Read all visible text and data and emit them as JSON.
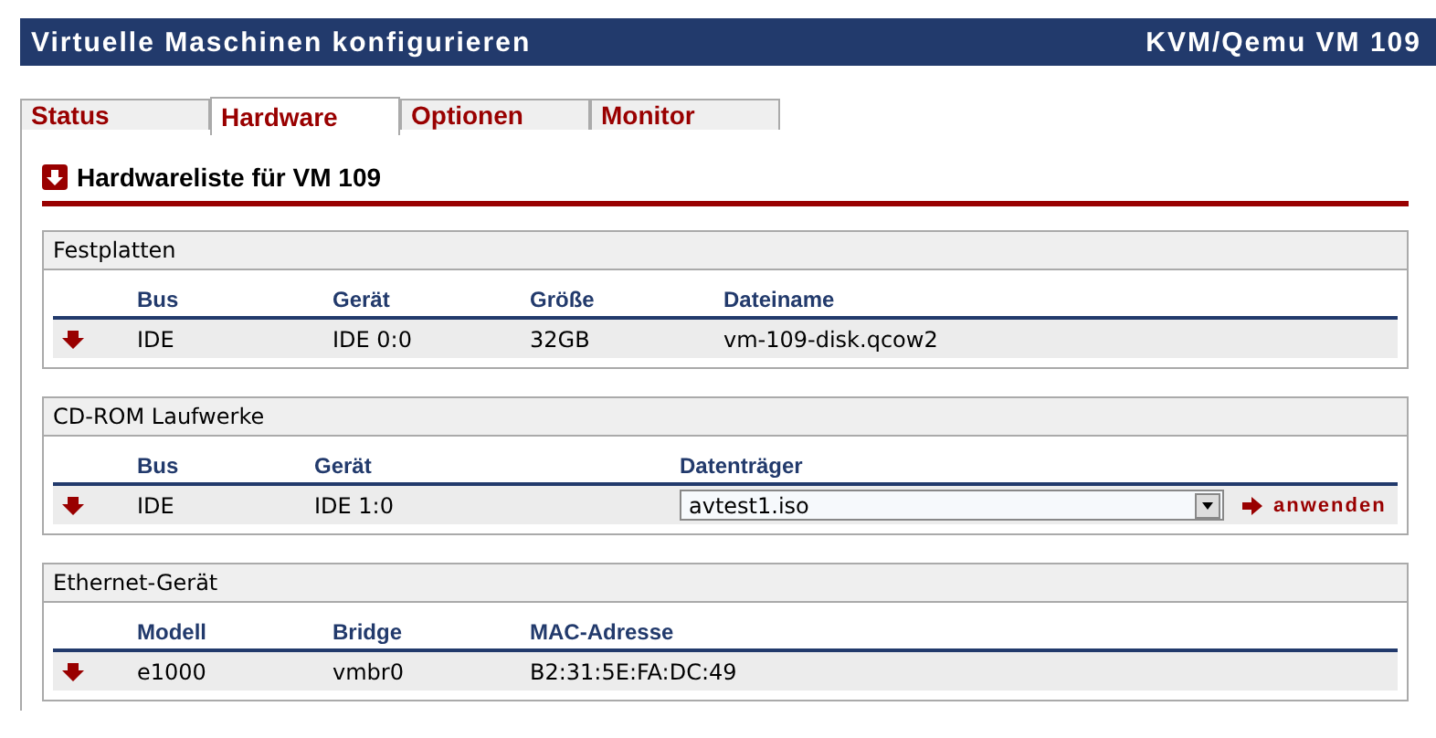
{
  "header": {
    "title": "Virtuelle Maschinen konfigurieren",
    "vm": "KVM/Qemu VM 109"
  },
  "tabs": [
    {
      "label": "Status",
      "selected": false
    },
    {
      "label": "Hardware",
      "selected": true
    },
    {
      "label": "Optionen",
      "selected": false
    },
    {
      "label": "Monitor",
      "selected": false
    }
  ],
  "heading": "Hardwareliste für VM 109",
  "sections": [
    {
      "title": "Festplatten",
      "columns": [
        "Bus",
        "Gerät",
        "Größe",
        "Dateiname"
      ],
      "rows": [
        {
          "cells": [
            "IDE",
            "IDE 0:0",
            "32GB",
            "vm-109-disk.qcow2"
          ]
        }
      ]
    },
    {
      "title": "CD-ROM Laufwerke",
      "columns": [
        "Bus",
        "Gerät",
        "Datenträger"
      ],
      "rows": [
        {
          "cells": [
            "IDE",
            "IDE 1:0"
          ],
          "select": "avtest1.iso",
          "action": "anwenden"
        }
      ]
    },
    {
      "title": "Ethernet-Gerät",
      "columns": [
        "Modell",
        "Bridge",
        "MAC-Adresse"
      ],
      "rows": [
        {
          "cells": [
            "e1000",
            "vmbr0",
            "B2:31:5E:FA:DC:49"
          ]
        }
      ]
    }
  ]
}
